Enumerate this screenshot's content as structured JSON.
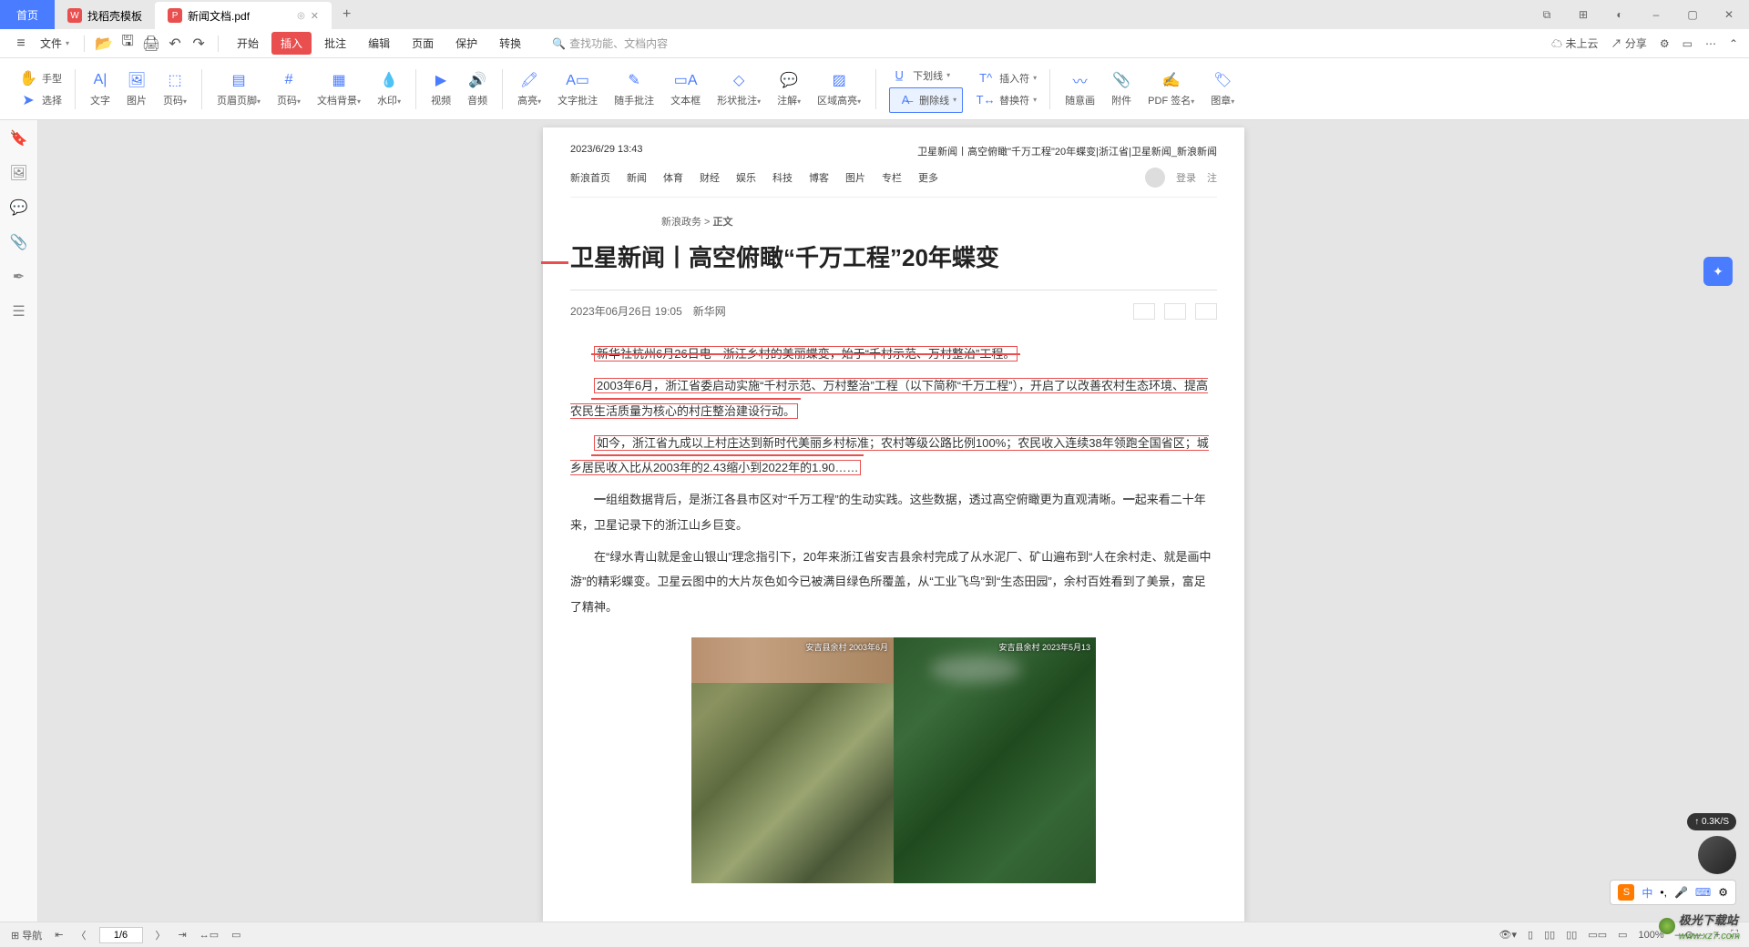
{
  "titlebar": {
    "home": "首页",
    "tab2_icon": "W",
    "tab2": "找稻壳模板",
    "tab3": "新闻文档.pdf",
    "add": "+"
  },
  "menu": {
    "file": "文件",
    "tabs": [
      "开始",
      "插入",
      "批注",
      "编辑",
      "页面",
      "保护",
      "转换"
    ],
    "active_index": 1,
    "search_placeholder": "查找功能、文档内容",
    "right": {
      "cloud": "未上云",
      "share": "分享"
    }
  },
  "toolbar": {
    "hand": "手型",
    "select": "选择",
    "text": "文字",
    "image": "图片",
    "pagenum": "页码",
    "headerfooter": "页眉页脚",
    "pagecode": "页码",
    "textbg": "文档背景",
    "watermark": "水印",
    "video": "视频",
    "audio": "音频",
    "highlight": "高亮",
    "textannot": "文字批注",
    "draftannot": "随手批注",
    "textbox": "文本框",
    "shapeannot": "形状批注",
    "annot": "注解",
    "areahl": "区域高亮",
    "underline": "下划线",
    "strikeline": "删除线",
    "insertchar": "插入符",
    "replacechar": "替换符",
    "freedraw": "随意画",
    "attachment": "附件",
    "pdfsign": "PDF 签名",
    "stamp": "图章"
  },
  "sidebar": [
    "bookmark",
    "image",
    "comment",
    "attach",
    "sign",
    "layers"
  ],
  "doc": {
    "ts": "2023/6/29 13:43",
    "headerline": "卫星新闻丨高空俯瞰\"千万工程\"20年蝶变|浙江省|卫星新闻_新浪新闻",
    "nav": [
      "新浪首页",
      "新闻",
      "体育",
      "财经",
      "娱乐",
      "科技",
      "博客",
      "图片",
      "专栏",
      "更多"
    ],
    "login": "登录",
    "reg": "注",
    "breadcrumb_a": "新浪政务 >",
    "breadcrumb_b": "正文",
    "title": "卫星新闻丨高空俯瞰“千万工程”20年蝶变",
    "date": "2023年06月26日 19:05",
    "source": "新华网",
    "p1": "新华社杭州6月26日电　浙江乡村的美丽蝶变，始于“千村示范、万村整治”工程。",
    "p2": "2003年6月，浙江省委启动实施“千村示范、万村整治”工程（以下简称“千万工程”），开启了以改善农村生态环境、提高农民生活质量为核心的村庄整治建设行动。",
    "p3": "如今，浙江省九成以上村庄达到新时代美丽乡村标准；农村等级公路比例100%；农民收入连续38年领跑全国省区；城乡居民收入比从2003年的2.43缩小到2022年的1.90……",
    "p4a": "一",
    "p4b": "组组数据背后，是浙江各县市区对“千万工程”的生动实践。这些数据，透过高空俯瞰更为直观清晰。",
    "p4c": "一",
    "p4d": "起来看二十年来，卫星记录下的浙江山乡巨变。",
    "p5": "在“绿水青山就是金山银山”理念指引下，20年来浙江省安吉县余村完成了从水泥厂、矿山遍布到“人在余村走、就是画中游”的精彩蝶变。卫星云图中的大片灰色如今已被满目绿色所覆盖，从“工业飞鸟”到“生态田园”，余村百姓看到了美景，富足了精神。",
    "sat_l": "安吉县余村\n2003年6月",
    "sat_r": "安吉县余村\n2023年5月13"
  },
  "status": {
    "nav": "导航",
    "page": "1/6",
    "zoom": "100%"
  },
  "float": {
    "speed": "0.3K/S"
  },
  "wm": {
    "a": "极光下载站",
    "b": "www.xz7.com"
  }
}
